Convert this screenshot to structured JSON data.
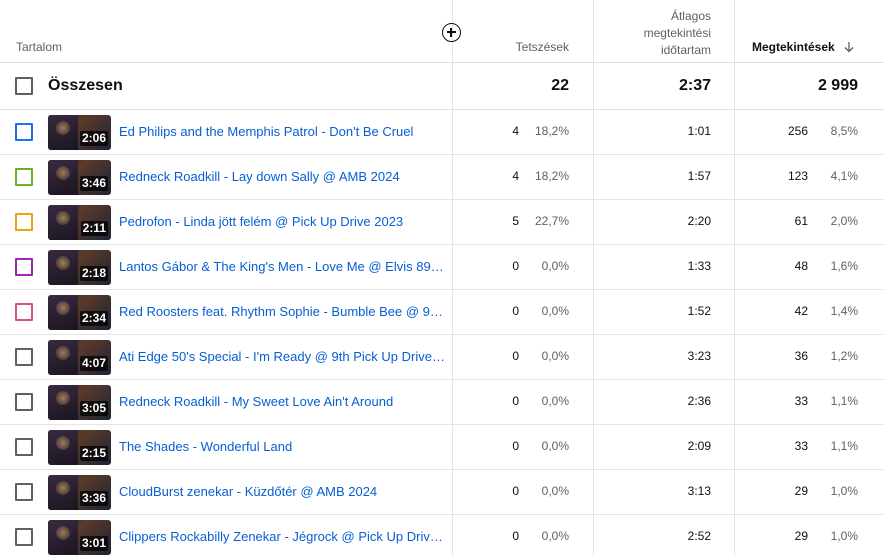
{
  "header": {
    "content_label": "Tartalom",
    "likes_label": "Tetszések",
    "avg_line1": "Átlagos",
    "avg_line2": "megtekintési",
    "avg_line3": "időtartam",
    "views_label": "Megtekintések"
  },
  "total": {
    "label": "Összesen",
    "likes": "22",
    "avg": "2:37",
    "views": "2 999"
  },
  "rows": [
    {
      "color": "#1a73e8",
      "duration": "2:06",
      "title": "Ed Philips and the Memphis Patrol - Don't Be Cruel",
      "likes": "4",
      "likes_pct": "18,2%",
      "avg": "1:01",
      "views": "256",
      "views_pct": "8,5%"
    },
    {
      "color": "#66b32e",
      "duration": "3:46",
      "title": "Redneck Roadkill - Lay down Sally @ AMB 2024",
      "likes": "4",
      "likes_pct": "18,2%",
      "avg": "1:57",
      "views": "123",
      "views_pct": "4,1%"
    },
    {
      "color": "#e8a317",
      "duration": "2:11",
      "title": "Pedrofon - Linda jött felém @ Pick Up Drive 2023",
      "likes": "5",
      "likes_pct": "22,7%",
      "avg": "2:20",
      "views": "61",
      "views_pct": "2,0%"
    },
    {
      "color": "#9c27b0",
      "duration": "2:18",
      "title": "Lantos Gábor & The King's Men - Love Me @ Elvis 89 (…",
      "likes": "0",
      "likes_pct": "0,0%",
      "avg": "1:33",
      "views": "48",
      "views_pct": "1,6%"
    },
    {
      "color": "#d4567a",
      "duration": "2:34",
      "title": "Red Roosters feat. Rhythm Sophie - Bumble Bee @ 9th …",
      "likes": "0",
      "likes_pct": "0,0%",
      "avg": "1:52",
      "views": "42",
      "views_pct": "1,4%"
    },
    {
      "color": "#606060",
      "duration": "4:07",
      "title": "Ati Edge 50's Special - I'm Ready @ 9th Pick Up Drive R…",
      "likes": "0",
      "likes_pct": "0,0%",
      "avg": "3:23",
      "views": "36",
      "views_pct": "1,2%"
    },
    {
      "color": "#606060",
      "duration": "3:05",
      "title": "Redneck Roadkill - My Sweet Love Ain't Around",
      "likes": "0",
      "likes_pct": "0,0%",
      "avg": "2:36",
      "views": "33",
      "views_pct": "1,1%"
    },
    {
      "color": "#606060",
      "duration": "2:15",
      "title": "The Shades - Wonderful Land",
      "likes": "0",
      "likes_pct": "0,0%",
      "avg": "2:09",
      "views": "33",
      "views_pct": "1,1%"
    },
    {
      "color": "#606060",
      "duration": "3:36",
      "title": "CloudBurst zenekar - Küzdőtér @ AMB 2024",
      "likes": "0",
      "likes_pct": "0,0%",
      "avg": "3:13",
      "views": "29",
      "views_pct": "1,0%"
    },
    {
      "color": "#606060",
      "duration": "3:01",
      "title": "Clippers Rockabilly Zenekar - Jégrock @ Pick Up Drive …",
      "likes": "0",
      "likes_pct": "0,0%",
      "avg": "2:52",
      "views": "29",
      "views_pct": "1,0%"
    }
  ],
  "icons": {
    "add_column": "plus-circle-icon",
    "sort": "arrow-down-icon"
  }
}
